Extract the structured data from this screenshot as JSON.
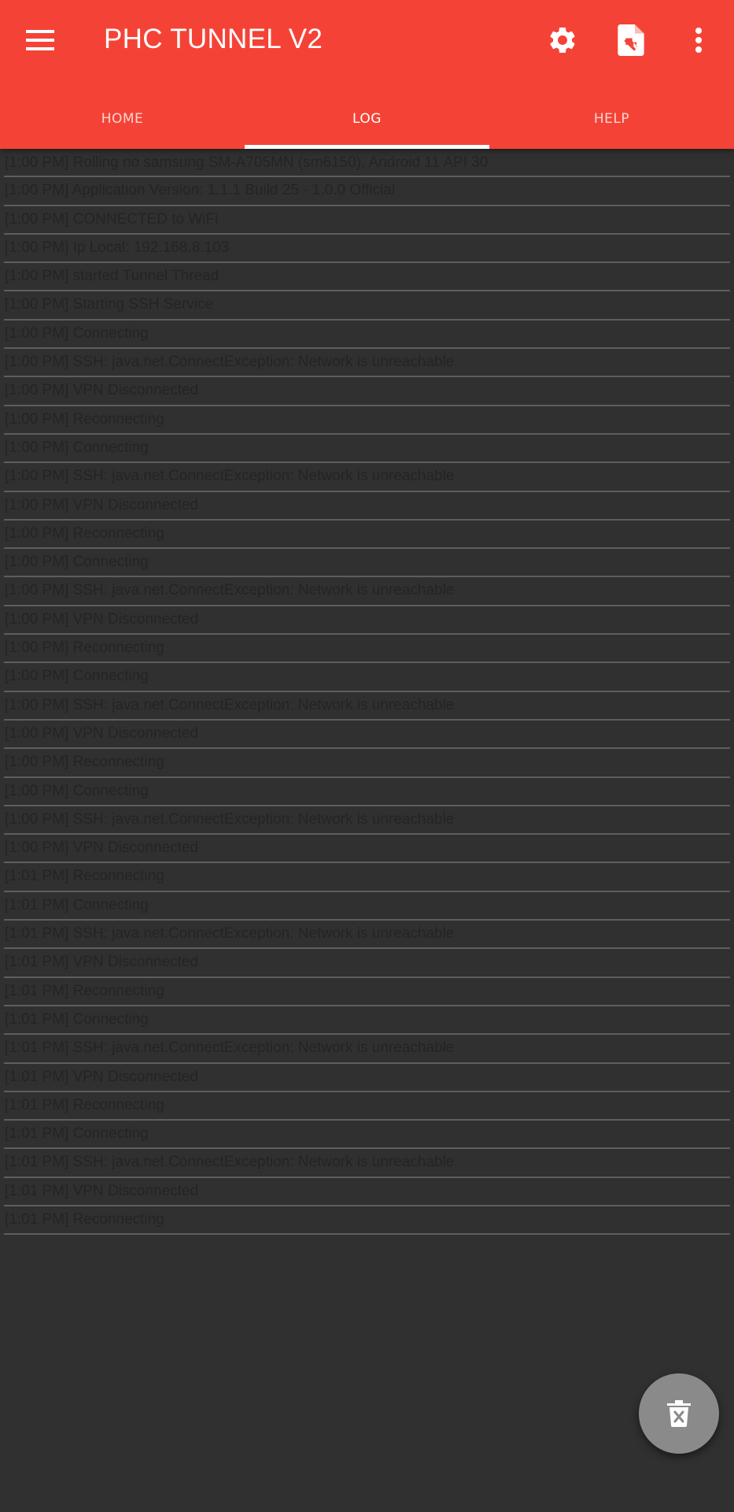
{
  "app": {
    "title": "PHC TUNNEL V2",
    "accent_color": "#f44336",
    "background_color": "#303030"
  },
  "toolbar": {
    "nav_icon": "menu-icon",
    "actions": [
      {
        "icon": "settings-gear-icon"
      },
      {
        "icon": "import-file-icon"
      },
      {
        "icon": "more-vert-icon"
      }
    ]
  },
  "tabs": [
    {
      "label": "HOME",
      "active": false
    },
    {
      "label": "LOG",
      "active": true
    },
    {
      "label": "HELP",
      "active": false
    }
  ],
  "log": [
    "[1:00 PM] Rolling no samsung SM-A705MN (sm6150), Android 11 API 30",
    "[1:00 PM] Application Version: 1.1.1 Build 25 - 1.0.0 Official",
    "[1:00 PM] CONNECTED to WiFi",
    "[1:00 PM] Ip Local: 192.168.8.103",
    "[1:00 PM] started Tunnel Thread",
    "[1:00 PM] Starting SSH Service",
    "[1:00 PM] Connecting",
    "[1:00 PM] SSH: java.net.ConnectException: Network is unreachable",
    "[1:00 PM] VPN Disconnected",
    "[1:00 PM] Reconnecting",
    "[1:00 PM] Connecting",
    "[1:00 PM] SSH: java.net.ConnectException: Network is unreachable",
    "[1:00 PM] VPN Disconnected",
    "[1:00 PM] Reconnecting",
    "[1:00 PM] Connecting",
    "[1:00 PM] SSH: java.net.ConnectException: Network is unreachable",
    "[1:00 PM] VPN Disconnected",
    "[1:00 PM] Reconnecting",
    "[1:00 PM] Connecting",
    "[1:00 PM] SSH: java.net.ConnectException: Network is unreachable",
    "[1:00 PM] VPN Disconnected",
    "[1:00 PM] Reconnecting",
    "[1:00 PM] Connecting",
    "[1:00 PM] SSH: java.net.ConnectException: Network is unreachable",
    "[1:00 PM] VPN Disconnected",
    "[1:01 PM] Reconnecting",
    "[1:01 PM] Connecting",
    "[1:01 PM] SSH: java.net.ConnectException: Network is unreachable",
    "[1:01 PM] VPN Disconnected",
    "[1:01 PM] Reconnecting",
    "[1:01 PM] Connecting",
    "[1:01 PM] SSH: java.net.ConnectException: Network is unreachable",
    "[1:01 PM] VPN Disconnected",
    "[1:01 PM] Reconnecting",
    "[1:01 PM] Connecting",
    "[1:01 PM] SSH: java.net.ConnectException: Network is unreachable",
    "[1:01 PM] VPN Disconnected",
    "[1:01 PM] Reconnecting"
  ],
  "fab": {
    "icon": "delete-icon"
  }
}
